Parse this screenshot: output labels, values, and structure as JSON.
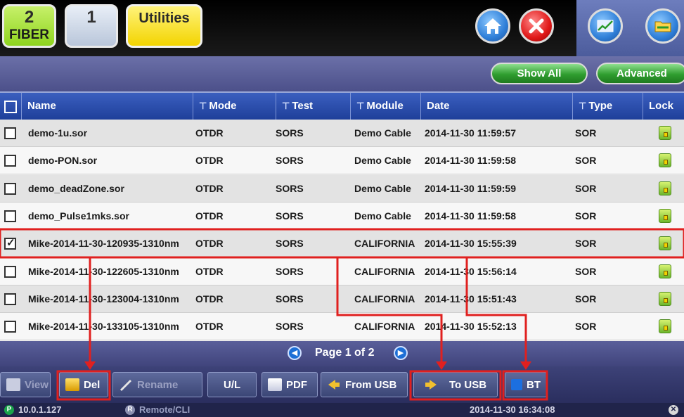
{
  "tabs": {
    "fiber_num": "2",
    "fiber_label": "FIBER",
    "second_num": "1",
    "utilities_label": "Utilities"
  },
  "toolbar": {
    "show_all": "Show All",
    "advanced": "Advanced"
  },
  "table": {
    "headers": [
      "Name",
      "Mode",
      "Test",
      "Module",
      "Date",
      "Type",
      "Lock"
    ],
    "rows": [
      {
        "checked": false,
        "name": "demo-1u.sor",
        "mode": "OTDR",
        "test": "SORS",
        "module": "Demo Cable",
        "date": "2014-11-30 11:59:57",
        "type": "SOR"
      },
      {
        "checked": false,
        "name": "demo-PON.sor",
        "mode": "OTDR",
        "test": "SORS",
        "module": "Demo Cable",
        "date": "2014-11-30 11:59:58",
        "type": "SOR"
      },
      {
        "checked": false,
        "name": "demo_deadZone.sor",
        "mode": "OTDR",
        "test": "SORS",
        "module": "Demo Cable",
        "date": "2014-11-30 11:59:59",
        "type": "SOR"
      },
      {
        "checked": false,
        "name": "demo_Pulse1mks.sor",
        "mode": "OTDR",
        "test": "SORS",
        "module": "Demo Cable",
        "date": "2014-11-30 11:59:58",
        "type": "SOR"
      },
      {
        "checked": true,
        "name": "Mike-2014-11-30-120935-1310nm",
        "mode": "OTDR",
        "test": "SORS",
        "module": "CALIFORNIA",
        "date": "2014-11-30 15:55:39",
        "type": "SOR"
      },
      {
        "checked": false,
        "name": "Mike-2014-11-30-122605-1310nm",
        "mode": "OTDR",
        "test": "SORS",
        "module": "CALIFORNIA",
        "date": "2014-11-30 15:56:14",
        "type": "SOR"
      },
      {
        "checked": false,
        "name": "Mike-2014-11-30-123004-1310nm",
        "mode": "OTDR",
        "test": "SORS",
        "module": "CALIFORNIA",
        "date": "2014-11-30 15:51:43",
        "type": "SOR"
      },
      {
        "checked": false,
        "name": "Mike-2014-11-30-133105-1310nm",
        "mode": "OTDR",
        "test": "SORS",
        "module": "CALIFORNIA",
        "date": "2014-11-30 15:52:13",
        "type": "SOR"
      }
    ]
  },
  "pager": {
    "text": "Page 1 of 2"
  },
  "buttons": {
    "view": "View",
    "del": "Del",
    "rename": "Rename",
    "ul": "U/L",
    "pdf": "PDF",
    "from_usb": "From USB",
    "to_usb": "To USB",
    "bt": "BT"
  },
  "status": {
    "ip": "10.0.1.127",
    "remote": "Remote/CLI",
    "datetime": "2014-11-30 16:34:08",
    "p_badge": "P",
    "r_badge": "R"
  },
  "colors": {
    "header_blue": "#1e3f9a",
    "annotation_red": "#e0201f",
    "pill_green": "#2f9e2f"
  }
}
